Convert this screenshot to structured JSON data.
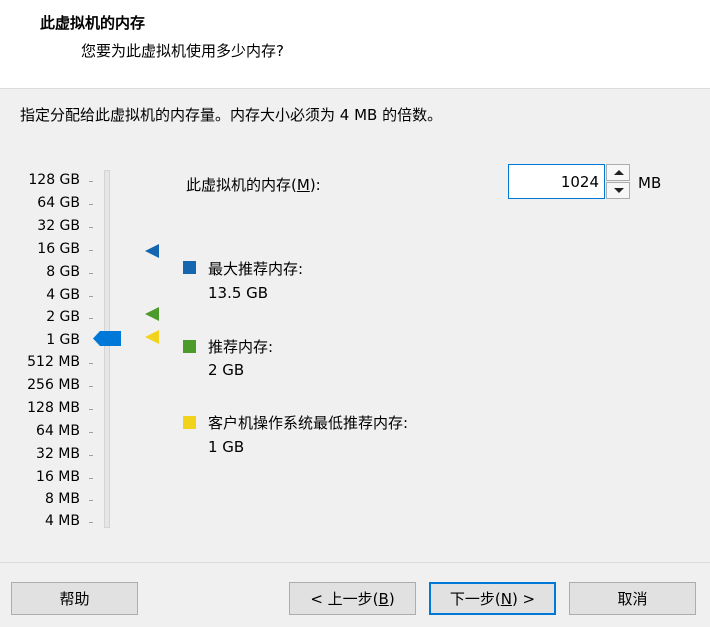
{
  "header": {
    "title": "此虚拟机的内存",
    "subtitle": "您要为此虚拟机使用多少内存?"
  },
  "description": "指定分配给此虚拟机的内存量。内存大小必须为 4 MB 的倍数。",
  "scale": {
    "labels": [
      "128 GB",
      "64 GB",
      "32 GB",
      "16 GB",
      "8 GB",
      "4 GB",
      "2 GB",
      "1 GB",
      "512 MB",
      "256 MB",
      "128 MB",
      "64 MB",
      "32 MB",
      "16 MB",
      "8 MB",
      "4 MB"
    ],
    "current": "1 GB"
  },
  "memory": {
    "label_prefix": "此虚拟机的内存(",
    "label_accel": "M",
    "label_suffix": "):",
    "value": "1024",
    "unit": "MB"
  },
  "legend": {
    "max": {
      "label": "最大推荐内存:",
      "value": "13.5 GB",
      "color": "#1565b0"
    },
    "recommended": {
      "label": "推荐内存:",
      "value": "2 GB",
      "color": "#4c9a2a"
    },
    "minimum": {
      "label": "客户机操作系统最低推荐内存:",
      "value": "1 GB",
      "color": "#f2d31b"
    }
  },
  "buttons": {
    "help": "帮助",
    "back_prefix": "< 上一步(",
    "back_accel": "B",
    "back_suffix": ")",
    "next_prefix": "下一步(",
    "next_accel": "N",
    "next_suffix": ") >",
    "cancel": "取消"
  },
  "colors": {
    "slider_thumb": "#0078d7",
    "focus_border": "#0078d7"
  }
}
